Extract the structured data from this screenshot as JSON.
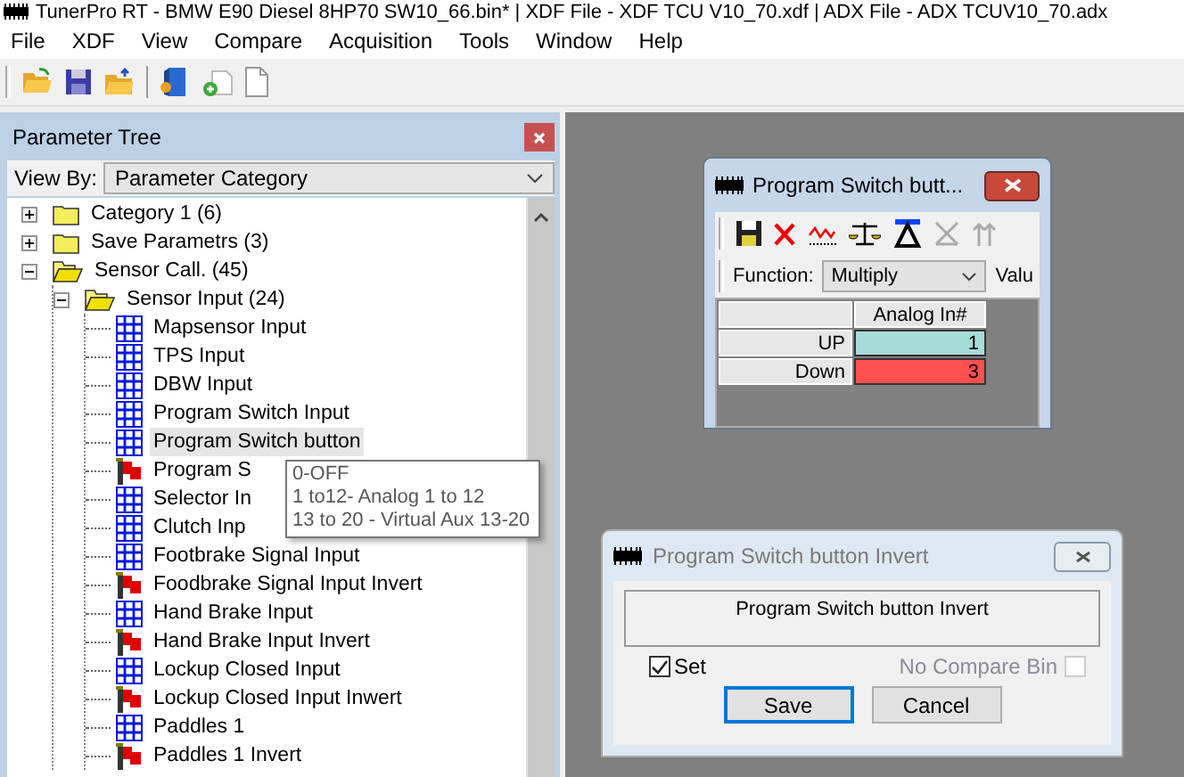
{
  "window": {
    "title": "TunerPro RT - BMW E90 Diesel 8HP70 SW10_66.bin* | XDF File - XDF TCU V10_70.xdf | ADX File - ADX TCUV10_70.adx"
  },
  "menu": [
    "File",
    "XDF",
    "View",
    "Compare",
    "Acquisition",
    "Tools",
    "Window",
    "Help"
  ],
  "parameter_tree": {
    "title": "Parameter Tree",
    "view_by_label": "View By:",
    "view_by_value": "Parameter Category",
    "items": [
      {
        "label": "Category 1 (6)",
        "kind": "folder",
        "expanded": false,
        "selected": false
      },
      {
        "label": "Save Parametrs (3)",
        "kind": "folder",
        "expanded": false,
        "selected": false
      },
      {
        "label": "Sensor Call. (45)",
        "kind": "folder",
        "expanded": true,
        "selected": false,
        "children": [
          {
            "label": "Sensor Input (24)",
            "kind": "folder",
            "expanded": true,
            "selected": false,
            "children": [
              {
                "label": "Mapsensor Input",
                "kind": "table",
                "selected": false
              },
              {
                "label": "TPS Input",
                "kind": "table",
                "selected": false
              },
              {
                "label": "DBW Input",
                "kind": "table",
                "selected": false
              },
              {
                "label": "Program Switch Input",
                "kind": "table",
                "selected": false
              },
              {
                "label": "Program Switch button",
                "kind": "table",
                "selected": true
              },
              {
                "label": "Program S",
                "kind": "flag",
                "selected": false
              },
              {
                "label": "Selector In",
                "kind": "table",
                "selected": false
              },
              {
                "label": "Clutch Inp",
                "kind": "table",
                "selected": false
              },
              {
                "label": "Footbrake Signal Input",
                "kind": "table",
                "selected": false
              },
              {
                "label": "Foodbrake Signal Input Invert",
                "kind": "flag",
                "selected": false
              },
              {
                "label": "Hand Brake Input",
                "kind": "table",
                "selected": false
              },
              {
                "label": "Hand Brake Input Invert",
                "kind": "flag",
                "selected": false
              },
              {
                "label": "Lockup Closed Input",
                "kind": "table",
                "selected": false
              },
              {
                "label": "Lockup Closed Input Inwert",
                "kind": "flag",
                "selected": false
              },
              {
                "label": "Paddles 1",
                "kind": "table",
                "selected": false
              },
              {
                "label": "Paddles 1 Invert",
                "kind": "flag",
                "selected": false
              }
            ]
          }
        ]
      }
    ]
  },
  "tooltip": {
    "lines": [
      "0-OFF",
      "1 to12- Analog 1 to 12",
      "13 to 20 - Virtual Aux 13-20"
    ]
  },
  "table_window": {
    "title": "Program Switch butt...",
    "function_label": "Function:",
    "function_value": "Multiply",
    "value_label": "Valu",
    "column": "Analog In#",
    "rows": [
      {
        "label": "UP",
        "value": "1",
        "color": "#a8dcd8"
      },
      {
        "label": "Down",
        "value": "3",
        "color": "#ff5050"
      }
    ]
  },
  "flag_dialog": {
    "title": "Program Switch button Invert",
    "description": "Program Switch button Invert",
    "checks": [
      {
        "label": "Set",
        "checked": true,
        "disabled": false
      },
      {
        "label": "No Compare Bin",
        "checked": false,
        "disabled": true
      }
    ],
    "buttons": [
      {
        "label": "Save",
        "default": true
      },
      {
        "label": "Cancel",
        "default": false
      }
    ]
  }
}
